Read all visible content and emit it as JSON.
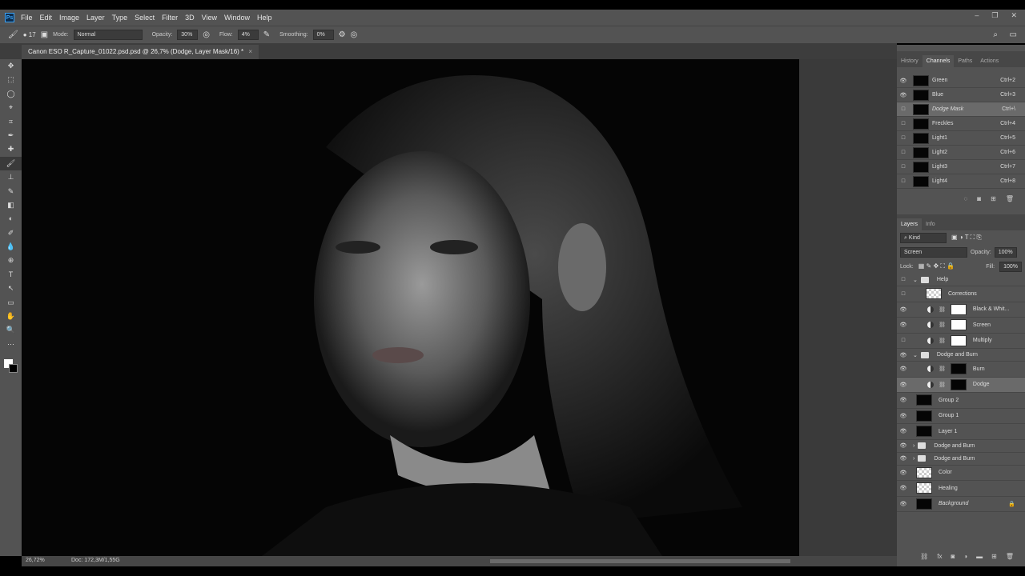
{
  "app": {
    "logo": "Ps"
  },
  "menu": [
    "File",
    "Edit",
    "Image",
    "Layer",
    "Type",
    "Select",
    "Filter",
    "3D",
    "View",
    "Window",
    "Help"
  ],
  "options": {
    "brush_size": "17",
    "mode_label": "Mode:",
    "mode": "Normal",
    "opacity_label": "Opacity:",
    "opacity": "30%",
    "flow_label": "Flow:",
    "flow": "4%",
    "smoothing_label": "Smoothing:",
    "smoothing": "0%"
  },
  "document": {
    "tab_title": "Canon ESO R_Capture_01022.psd.psd @ 26,7% (Dodge, Layer Mask/16) *",
    "close": "×"
  },
  "status": {
    "zoom": "26,72%",
    "doc": "Doc: 172,3M/1,55G"
  },
  "channels_panel": {
    "tabs": [
      "History",
      "Channels",
      "Paths",
      "Actions"
    ],
    "active": "Channels",
    "channels": [
      {
        "name": "Green",
        "shortcut": "Ctrl+2",
        "visible": true
      },
      {
        "name": "Blue",
        "shortcut": "Ctrl+3",
        "visible": true
      },
      {
        "name": "Dodge Mask",
        "shortcut": "Ctrl+\\",
        "visible": false,
        "selected": true
      },
      {
        "name": "Freckles",
        "shortcut": "Ctrl+4",
        "visible": false
      },
      {
        "name": "Light1",
        "shortcut": "Ctrl+5",
        "visible": false
      },
      {
        "name": "Light2",
        "shortcut": "Ctrl+6",
        "visible": false
      },
      {
        "name": "Light3",
        "shortcut": "Ctrl+7",
        "visible": false
      },
      {
        "name": "Light4",
        "shortcut": "Ctrl+8",
        "visible": false
      }
    ]
  },
  "layers_panel": {
    "tabs": [
      "Layers",
      "Info"
    ],
    "filter": "Kind",
    "blend": "Screen",
    "opacity_label": "Opacity:",
    "opacity": "100%",
    "lock_label": "Lock:",
    "fill_label": "Fill:",
    "fill": "100%",
    "layers": [
      {
        "name": "Help",
        "type": "group",
        "visible": false,
        "indent": 0
      },
      {
        "name": "Corrections",
        "type": "pixel",
        "visible": false,
        "indent": 1
      },
      {
        "name": "Black & Whit...",
        "type": "adjust",
        "visible": true,
        "indent": 1
      },
      {
        "name": "Screen",
        "type": "adjust",
        "visible": true,
        "indent": 1
      },
      {
        "name": "Multiply",
        "type": "adjust",
        "visible": false,
        "indent": 1
      },
      {
        "name": "Dodge and Burn",
        "type": "group",
        "visible": true,
        "indent": 0
      },
      {
        "name": "Burn",
        "type": "adjust-dark",
        "visible": true,
        "indent": 1
      },
      {
        "name": "Dodge",
        "type": "adjust-dark",
        "visible": true,
        "indent": 1,
        "selected": true
      },
      {
        "name": "Group 2",
        "type": "photo",
        "visible": true,
        "indent": 0
      },
      {
        "name": "Group 1",
        "type": "photo",
        "visible": true,
        "indent": 0
      },
      {
        "name": "Layer 1",
        "type": "photo",
        "visible": true,
        "indent": 0
      },
      {
        "name": "Dodge and Burn",
        "type": "group-closed",
        "visible": true,
        "indent": 0
      },
      {
        "name": "Dodge and Burn",
        "type": "group-closed",
        "visible": true,
        "indent": 0
      },
      {
        "name": "Color",
        "type": "pixel",
        "visible": true,
        "indent": 0
      },
      {
        "name": "Healing",
        "type": "pixel",
        "visible": true,
        "indent": 0
      },
      {
        "name": "Background",
        "type": "photo",
        "visible": true,
        "indent": 0,
        "locked": true
      }
    ]
  }
}
